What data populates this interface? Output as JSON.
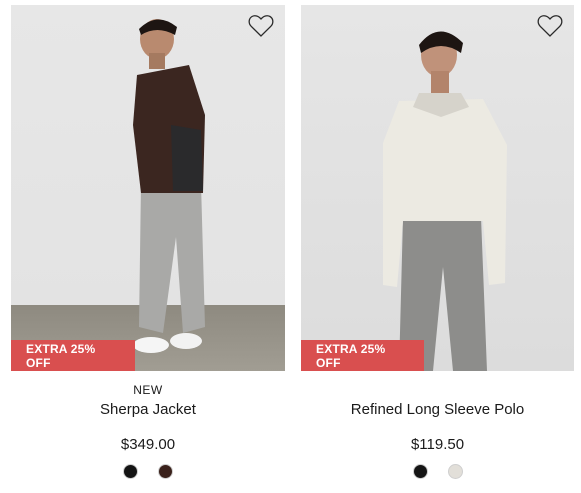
{
  "products": [
    {
      "badge": "EXTRA 25% OFF",
      "tag": "NEW",
      "name": "Sherpa Jacket",
      "price": "$349.00",
      "swatches": [
        "#141414",
        "#3a211b"
      ]
    },
    {
      "badge": "EXTRA 25% OFF",
      "tag": "",
      "name": "Refined Long Sleeve Polo",
      "price": "$119.50",
      "swatches": [
        "#151515",
        "#e2dfd9"
      ]
    }
  ]
}
